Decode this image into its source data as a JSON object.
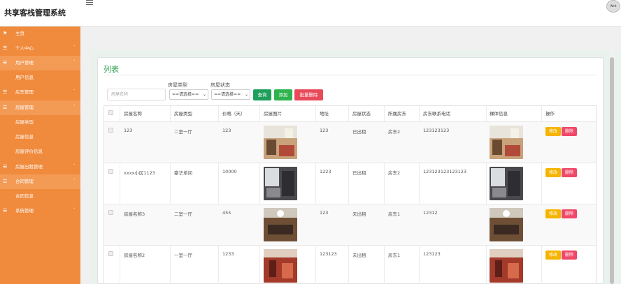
{
  "app": {
    "title": "共享客栈管理系统",
    "avatar_text": "Welt"
  },
  "sidebar": {
    "items": [
      {
        "label": "主页",
        "icon": "flag-icon",
        "glyph": "⚑",
        "expandable": false
      },
      {
        "label": "个人中心",
        "icon": "list-icon",
        "glyph": "☰",
        "expandable": true
      },
      {
        "label": "用户管理",
        "icon": "list-icon",
        "glyph": "☰",
        "expandable": true
      },
      {
        "label": "用户信息",
        "child": true
      },
      {
        "label": "房东管理",
        "icon": "list-icon",
        "glyph": "☰",
        "expandable": true
      },
      {
        "label": "房屋管理",
        "icon": "list-icon",
        "glyph": "☰",
        "expandable": true
      },
      {
        "label": "房屋类型",
        "child": true
      },
      {
        "label": "房屋信息",
        "child": true
      },
      {
        "label": "房屋评价信息",
        "child": true
      },
      {
        "label": "房屋出租管理",
        "icon": "list-icon",
        "glyph": "☰",
        "expandable": true
      },
      {
        "label": "合同管理",
        "icon": "list-icon",
        "glyph": "☰",
        "expandable": true
      },
      {
        "label": "合同信息",
        "child": true
      },
      {
        "label": "系统管理",
        "icon": "list-icon",
        "glyph": "☰",
        "expandable": true
      }
    ]
  },
  "main": {
    "title": "列表",
    "filters": {
      "name_placeholder": "房屋名称",
      "type_label": "房屋类型",
      "type_value": "==请选择==",
      "status_label": "房屋状态",
      "status_value": "==请选择=="
    },
    "buttons": {
      "search": "查询",
      "add": "添加",
      "batch_delete": "批量删除"
    },
    "table": {
      "headers": [
        "房屋名称",
        "房屋类型",
        "价格（天）",
        "房屋图片",
        "地址",
        "房屋状态",
        "所属房东",
        "房东联系电话",
        "裸体信息",
        "操作"
      ],
      "edit_label": "修改",
      "delete_label": "删除",
      "rows": [
        {
          "name": "123",
          "type": "二室一厅",
          "price": "123",
          "address": "123",
          "status": "已出租",
          "landlord": "房东2",
          "phone": "123123123"
        },
        {
          "name": "xxxx小区1123",
          "type": "豪华单间",
          "price": "10000",
          "address": "1223",
          "status": "已出租",
          "landlord": "房东2",
          "phone": "123123123123123"
        },
        {
          "name": "房屋名称3",
          "type": "二室一厅",
          "price": "455",
          "address": "123",
          "status": "未出租",
          "landlord": "房东1",
          "phone": "12312"
        },
        {
          "name": "房屋名称2",
          "type": "一室一厅",
          "price": "1233",
          "address": "123123",
          "status": "未出租",
          "landlord": "房东1",
          "phone": "123123"
        }
      ]
    }
  },
  "colors": {
    "sidebar": "#f08a3c",
    "accent_green": "#2aa14a",
    "edit": "#f5b400",
    "delete": "#ef4868"
  }
}
